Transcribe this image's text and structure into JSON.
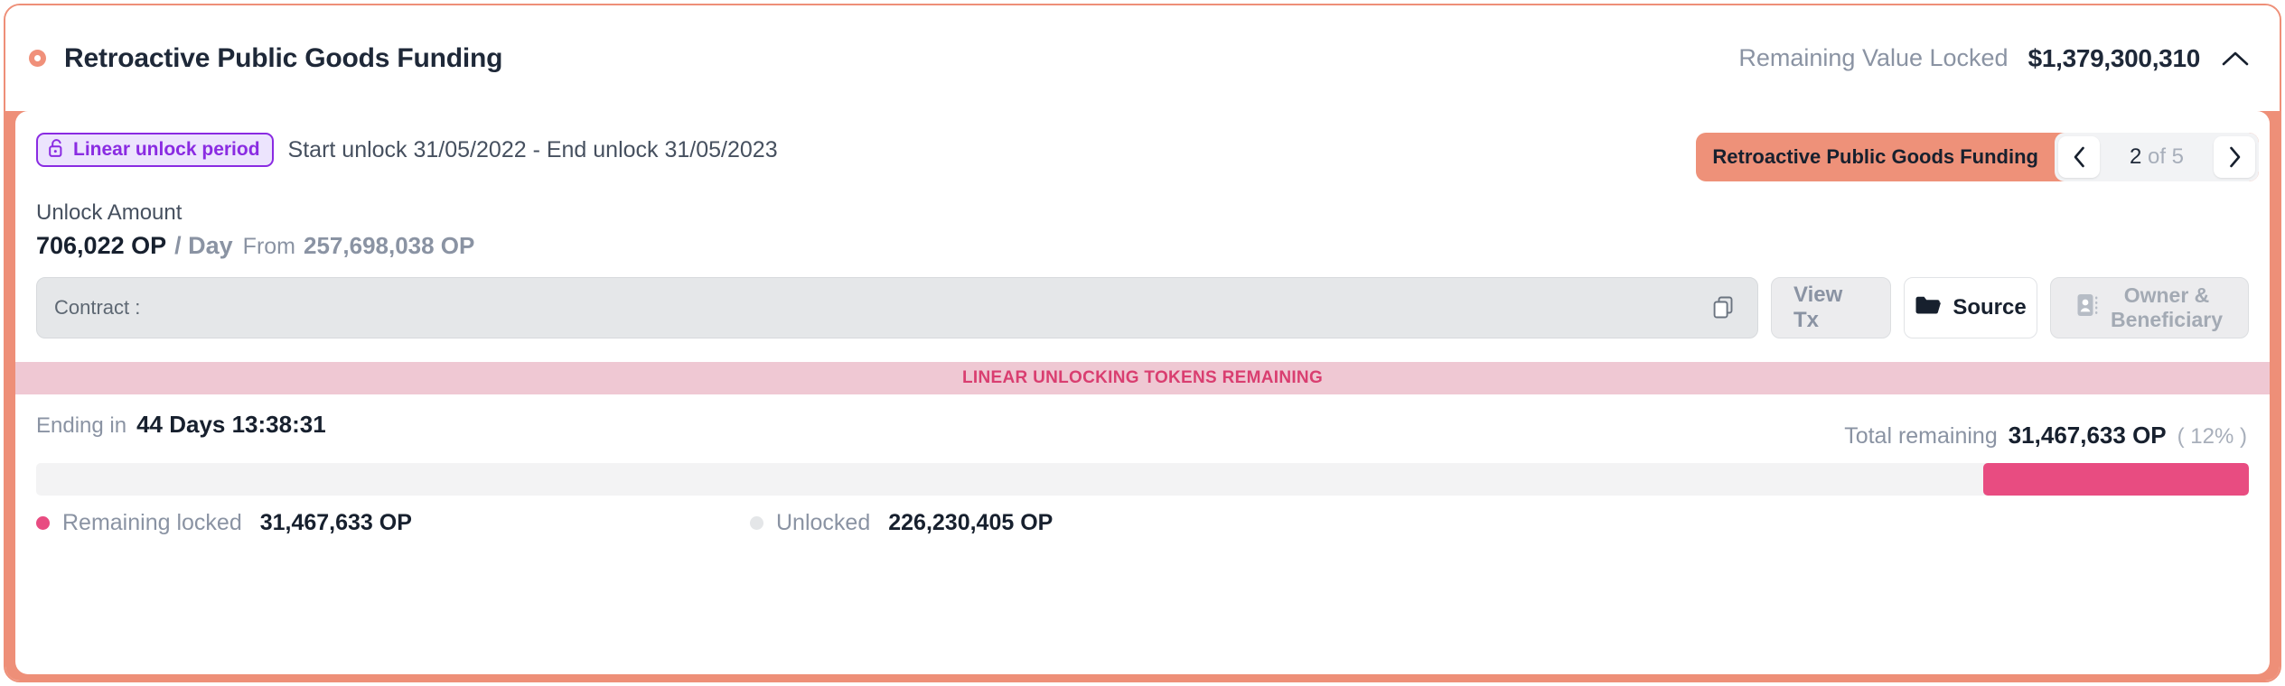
{
  "header": {
    "token_dot": "token-dot",
    "title": "Retroactive Public Goods Funding",
    "rvl_label": "Remaining Value Locked",
    "rvl_value": "$1,379,300,310",
    "collapse_icon": "chevron-up-icon"
  },
  "unlock": {
    "badge_label": "Linear unlock period",
    "badge_icon": "unlock-padlock-icon",
    "date_range": "Start unlock 31/05/2022 - End unlock 31/05/2023",
    "amount_label": "Unlock Amount",
    "amount_value": "706,022 OP",
    "amount_period": "/ Day",
    "amount_from_label": "From",
    "amount_from_value": "257,698,038 OP"
  },
  "pagination": {
    "current_name": "Retroactive Public Goods Funding",
    "prev_icon": "chevron-left-icon",
    "next_icon": "chevron-right-icon",
    "current_page": "2",
    "of_label": "of",
    "total_pages": "5"
  },
  "contract": {
    "label": "Contract :",
    "value": "",
    "copy_icon": "copy-icon",
    "view_tx_label": "View Tx",
    "source_label": "Source",
    "source_icon": "folder-icon",
    "owner_icon": "contact-card-icon",
    "owner_line1": "Owner &",
    "owner_line2": "Beneficiary"
  },
  "banner": {
    "text": "LINEAR UNLOCKING TOKENS REMAINING"
  },
  "countdown": {
    "label": "Ending in",
    "value": "44 Days 13:38:31"
  },
  "total": {
    "label": "Total remaining",
    "value": "31,467,633 OP",
    "percent": "( 12% )"
  },
  "progress": {
    "fill_percent": 12,
    "fill_color": "#e84c81",
    "track_color": "#f3f3f4"
  },
  "legend": [
    {
      "name": "Remaining locked",
      "value": "31,467,633 OP",
      "color": "#e84c81"
    },
    {
      "name": "Unlocked",
      "value": "226,230,405 OP",
      "color": "#e4e6e8"
    }
  ],
  "colors": {
    "accent_coral": "#ee8f78",
    "purple": "#8a2be2",
    "pink": "#e84c81",
    "banner_bg": "#efc8d3",
    "banner_text": "#d93e70"
  }
}
